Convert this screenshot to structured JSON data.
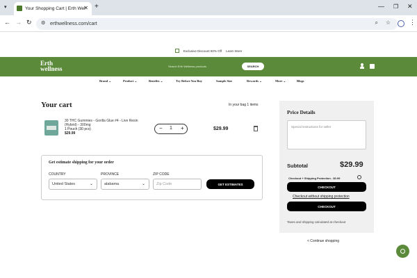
{
  "browser": {
    "tab_title": "Your Shopping Cart | Erth Wel",
    "url": "erthwellness.com/cart"
  },
  "promo": {
    "text": "Exclusive Discount 50% Off",
    "link": "Learn More"
  },
  "header": {
    "logo_line1": "Erth",
    "logo_line2": "wellness",
    "search_placeholder": "Search Erth Wellness products",
    "search_button": "SEARCH",
    "nav": [
      "Brand ⌄",
      "Product ⌄",
      "Benefits ⌄",
      "Try Before You Buy",
      "Sample Size",
      "Rewards ⌄",
      "More ⌄",
      "Blogs"
    ]
  },
  "cart": {
    "title": "Your cart",
    "count_text": "In your bag 1 items",
    "item": {
      "name": "30 THC Gummies - Gorilla Glue #4 - Live Resin (Hybrid) - 300mg",
      "variant": "1 Pouch (30 pcs)",
      "price": "$29.99",
      "quantity": "1",
      "total": "$29.99"
    }
  },
  "shipping": {
    "title": "Get estimate shipping for your order",
    "country_label": "COUNTRY",
    "country_value": "United States",
    "province_label": "PROVINCE",
    "province_value": "alabama",
    "zip_label": "ZIP CODE",
    "zip_placeholder": "Zip Code",
    "button": "GET ESTIMATES"
  },
  "price_details": {
    "title": "Price Details",
    "instructions_placeholder": "Special instructions for seller",
    "subtotal_label": "Subtotal",
    "subtotal_value": "$29.99",
    "protection_text": "Checkout + Shipping Protection - $0.99",
    "checkout_button": "CHECKOUT",
    "without_protection_link": "Checkout without shipping protection",
    "checkout_button2": "CHECKOUT",
    "taxes_note": "Taxes and shipping calculated at checkout"
  },
  "continue_shopping": "< Continue shopping",
  "colors": {
    "brand_green": "#5b8a3a",
    "panel_gray": "#f0f0f0"
  }
}
